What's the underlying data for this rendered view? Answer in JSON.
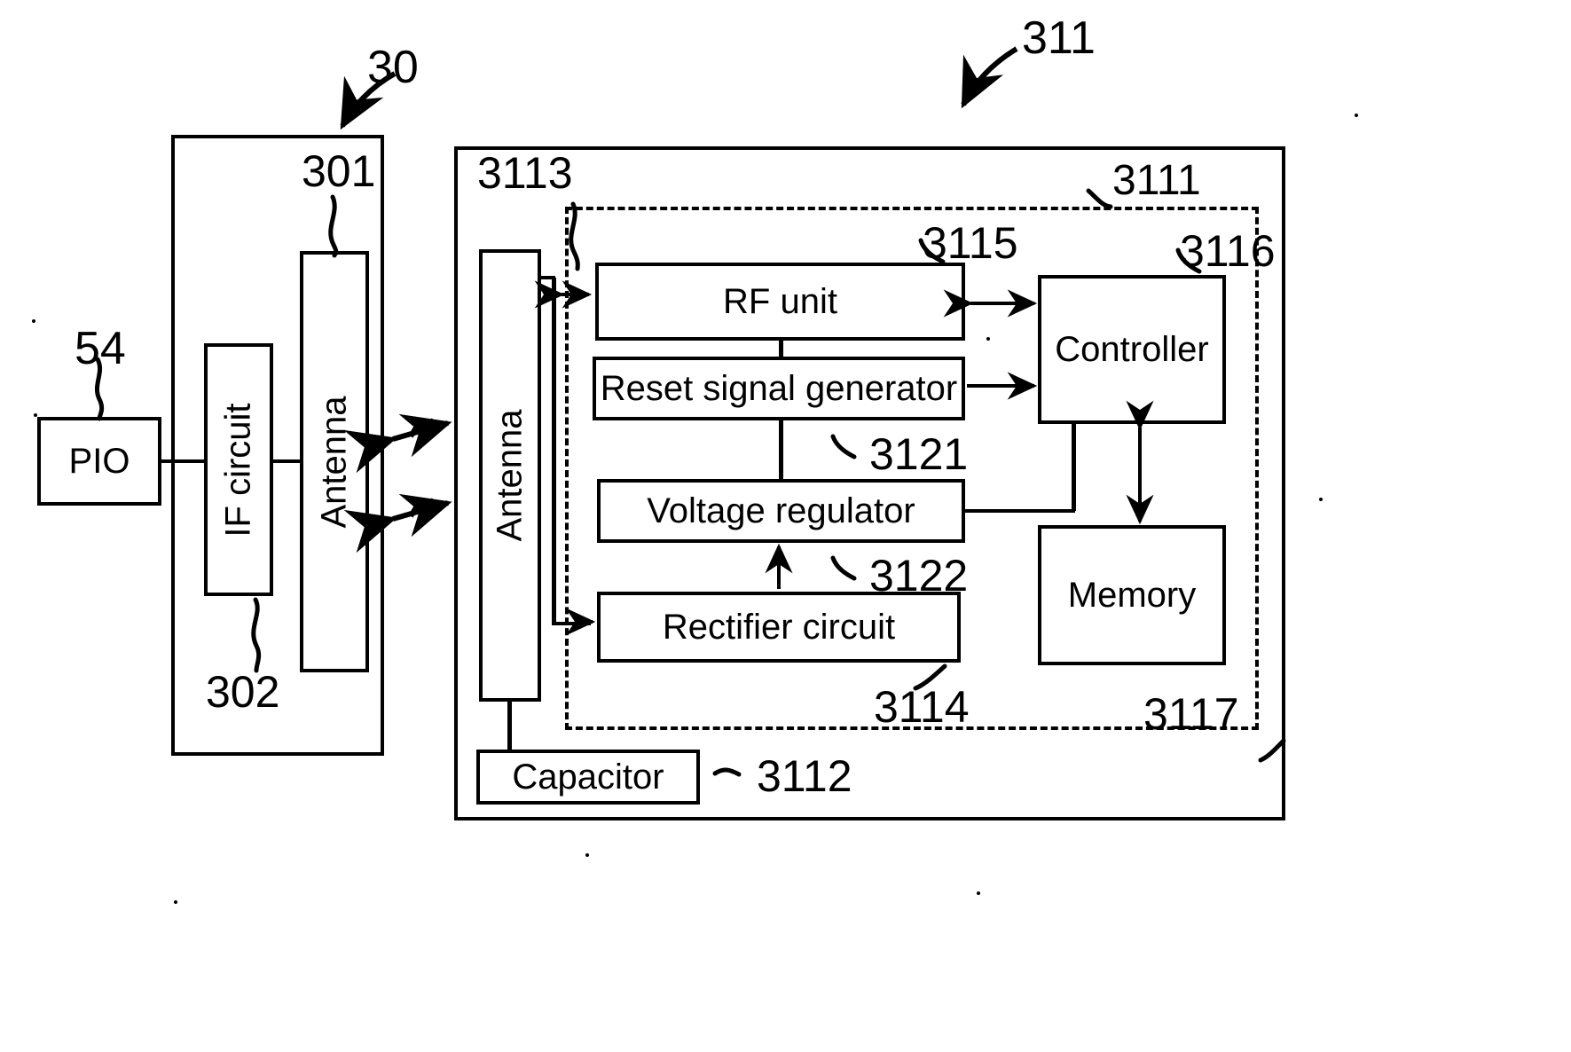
{
  "figure": {
    "type": "patent-block-diagram",
    "description": "Wireless reader/tag block diagram"
  },
  "reader_unit": {
    "ref": "30",
    "blocks": [
      {
        "id": "pio",
        "label": "PIO",
        "ref": "54",
        "orientation": "horizontal"
      },
      {
        "id": "if_circuit",
        "label": "IF circuit",
        "ref": "302",
        "orientation": "vertical"
      },
      {
        "id": "reader_antenna",
        "label": "Antenna",
        "ref": "301",
        "orientation": "vertical"
      }
    ]
  },
  "tag_unit": {
    "ref": "311",
    "inner_ref": "3111",
    "blocks": [
      {
        "id": "tag_antenna",
        "label": "Antenna",
        "ref": "3113",
        "orientation": "vertical"
      },
      {
        "id": "rf_unit",
        "label": "RF unit",
        "ref": "3115",
        "orientation": "horizontal"
      },
      {
        "id": "reset_signal_generator",
        "label": "Reset signal generator",
        "ref": "3121",
        "orientation": "horizontal"
      },
      {
        "id": "voltage_regulator",
        "label": "Voltage regulator",
        "ref": "3122",
        "orientation": "horizontal"
      },
      {
        "id": "rectifier_circuit",
        "label": "Rectifier circuit",
        "ref": "3114",
        "orientation": "horizontal"
      },
      {
        "id": "controller",
        "label": "Controller",
        "ref": "3116",
        "orientation": "horizontal"
      },
      {
        "id": "memory",
        "label": "Memory",
        "ref": "3117",
        "orientation": "horizontal"
      },
      {
        "id": "capacitor",
        "label": "Capacitor",
        "ref": "3112",
        "orientation": "horizontal"
      }
    ]
  },
  "reference_numerals": {
    "n30": "30",
    "n54": "54",
    "n301": "301",
    "n302": "302",
    "n311": "311",
    "n3111": "3111",
    "n3112": "3112",
    "n3113": "3113",
    "n3114": "3114",
    "n3115": "3115",
    "n3116": "3116",
    "n3117": "3117",
    "n3121": "3121",
    "n3122": "3122"
  },
  "labels": {
    "pio": "PIO",
    "if_circuit": "IF circuit",
    "antenna_reader": "Antenna",
    "antenna_tag": "Antenna",
    "rf_unit": "RF unit",
    "reset_signal_generator": "Reset signal generator",
    "voltage_regulator": "Voltage regulator",
    "rectifier_circuit": "Rectifier circuit",
    "controller": "Controller",
    "memory": "Memory",
    "capacitor": "Capacitor"
  },
  "colors": {
    "line": "#000000",
    "background": "#ffffff"
  },
  "wireless_link": {
    "symbol": "radio-wave-double-arrow",
    "count": 2
  }
}
